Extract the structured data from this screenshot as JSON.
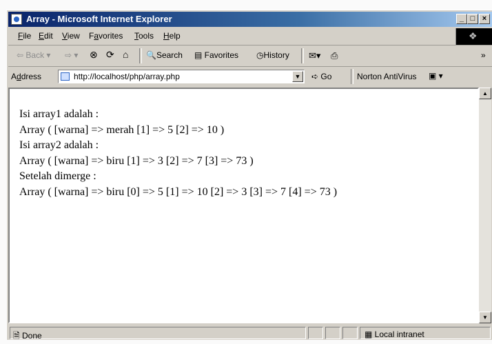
{
  "window": {
    "title": "Array - Microsoft Internet Explorer"
  },
  "menu": {
    "file": {
      "accel": "F",
      "rest": "ile"
    },
    "edit": {
      "accel": "E",
      "rest": "dit"
    },
    "view": {
      "accel": "V",
      "rest": "iew"
    },
    "favorites": {
      "pre": "F",
      "accel": "a",
      "rest": "vorites"
    },
    "tools": {
      "accel": "T",
      "rest": "ools"
    },
    "help": {
      "accel": "H",
      "rest": "elp"
    }
  },
  "toolbar": {
    "back": "Back",
    "search": "Search",
    "favorites": "Favorites",
    "history": "History",
    "overflow": "»"
  },
  "address": {
    "label_pre": "A",
    "label_accel": "d",
    "label_rest": "dress",
    "url": "http://localhost/php/array.php",
    "go": "Go",
    "links": "Norton AntiVirus"
  },
  "page": {
    "lines": [
      "Isi array1 adalah :",
      "Array ( [warna] => merah [1] => 5 [2] => 10 )",
      "Isi array2 adalah :",
      "Array ( [warna] => biru [1] => 3 [2] => 7 [3] => 73 )",
      "Setelah dimerge :",
      "Array ( [warna] => biru [0] => 5 [1] => 10 [2] => 3 [3] => 7 [4] => 73 )"
    ]
  },
  "status": {
    "left": "Done",
    "zone": "Local intranet"
  }
}
